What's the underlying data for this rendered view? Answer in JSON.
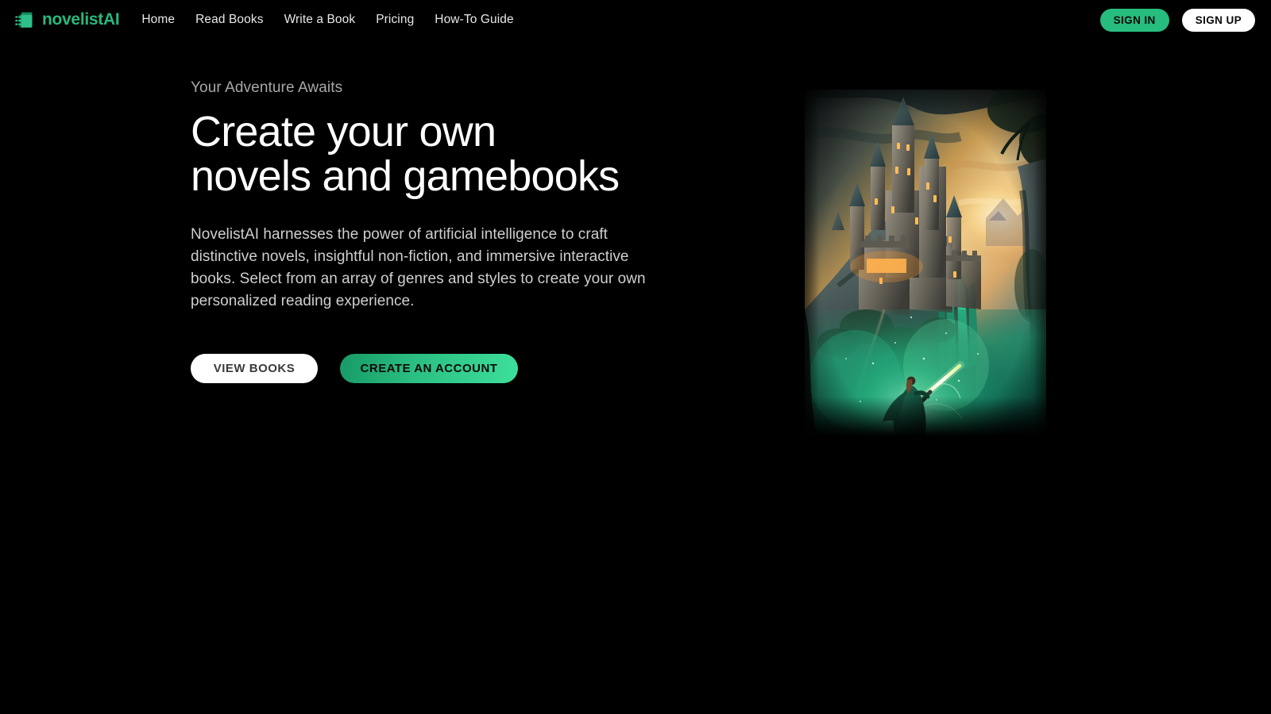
{
  "brand": {
    "name": "novelistAI",
    "icon": "book-lines-icon",
    "color": "#29b87d"
  },
  "nav": {
    "links": [
      {
        "label": "Home"
      },
      {
        "label": "Read Books"
      },
      {
        "label": "Write a Book"
      },
      {
        "label": "Pricing"
      },
      {
        "label": "How-To Guide"
      }
    ],
    "sign_in_label": "SIGN IN",
    "sign_up_label": "SIGN UP",
    "sign_in_color": "#27bd7e",
    "sign_up_color": "#ffffff"
  },
  "hero": {
    "eyebrow": "Your Adventure Awaits",
    "title": "Create your own\nnovels and gamebooks",
    "description": "NovelistAI harnesses the power of artificial intelligence to craft distinctive novels, insightful non-fiction, and immersive interactive books. Select from an array of genres and styles to create your own personalized reading experience.",
    "primary_cta": "CREATE AN ACCOUNT",
    "secondary_cta": "VIEW BOOKS",
    "primary_cta_color": "#2cc184",
    "secondary_cta_color": "#ffffff",
    "artwork_alt": "Fantasy castle on a cliff at sunset with a cloaked figure holding a glowing sword"
  },
  "page": {
    "background": "#000000"
  }
}
